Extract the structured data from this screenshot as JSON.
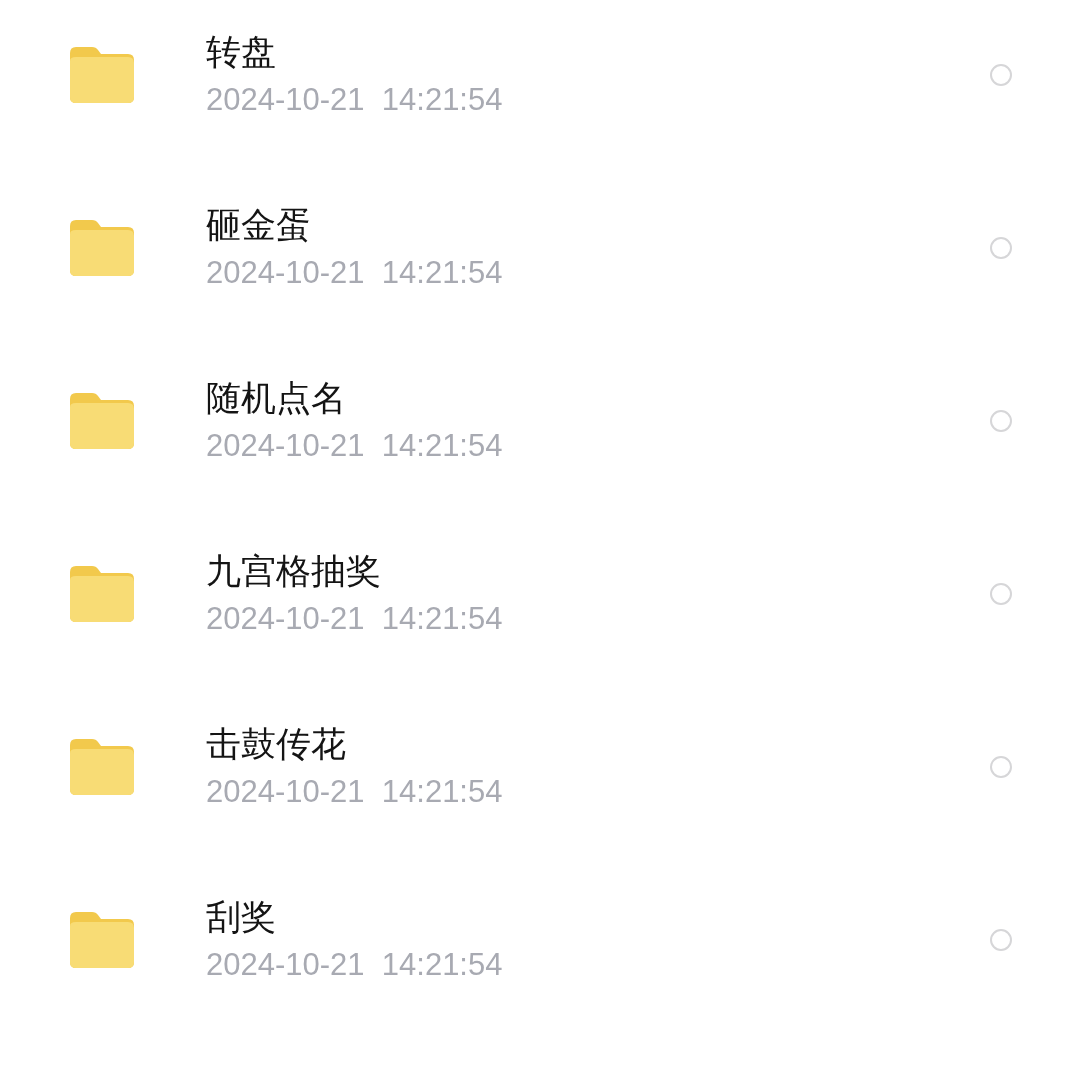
{
  "files": [
    {
      "name": "转盘",
      "date": "2024-10-21  14:21:54",
      "selected": false
    },
    {
      "name": "砸金蛋",
      "date": "2024-10-21  14:21:54",
      "selected": false
    },
    {
      "name": "随机点名",
      "date": "2024-10-21  14:21:54",
      "selected": false
    },
    {
      "name": "九宫格抽奖",
      "date": "2024-10-21  14:21:54",
      "selected": false
    },
    {
      "name": "击鼓传花",
      "date": "2024-10-21  14:21:54",
      "selected": false
    },
    {
      "name": "刮奖",
      "date": "2024-10-21  14:21:54",
      "selected": false
    }
  ]
}
